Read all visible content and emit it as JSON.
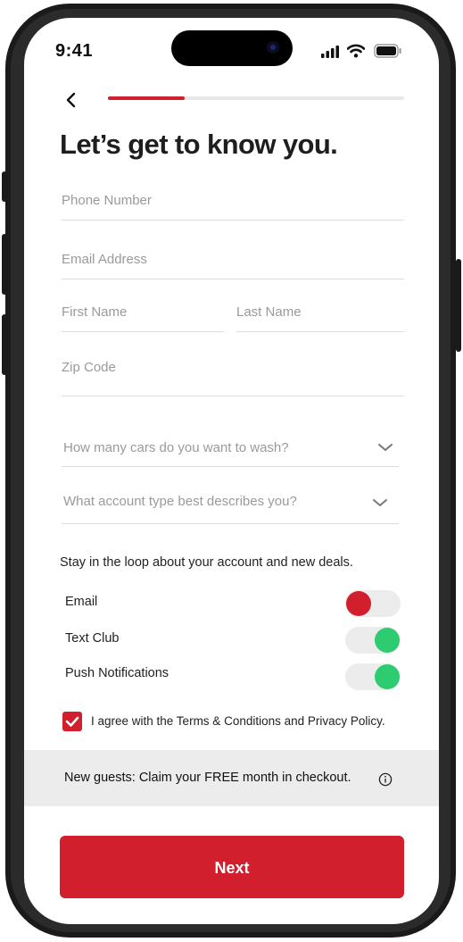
{
  "status_bar": {
    "time": "9:41"
  },
  "header": {
    "title": "Let’s get to know you.",
    "progress": 0.26
  },
  "form": {
    "phone_placeholder": "Phone Number",
    "email_placeholder": "Email Address",
    "first_name_placeholder": "First Name",
    "last_name_placeholder": "Last Name",
    "zip_placeholder": "Zip Code",
    "cars_select": "How many cars do you want to wash?",
    "account_type_select": "What account type best describes you?"
  },
  "notifications": {
    "intro": "Stay in the loop about your account and new deals.",
    "toggles": [
      {
        "label": "Email",
        "on": false
      },
      {
        "label": "Text Club",
        "on": true
      },
      {
        "label": "Push Notifications",
        "on": true
      }
    ]
  },
  "agreement": {
    "text": "I agree with the Terms & Conditions and Privacy Policy.",
    "checked": true
  },
  "banner": {
    "text": "New guests: Claim your FREE month in checkout."
  },
  "footer": {
    "next_label": "Next"
  },
  "colors": {
    "brand_red": "#d11f2d",
    "toggle_on": "#2ecc71",
    "toggle_off_knob": "#d11f2d"
  }
}
